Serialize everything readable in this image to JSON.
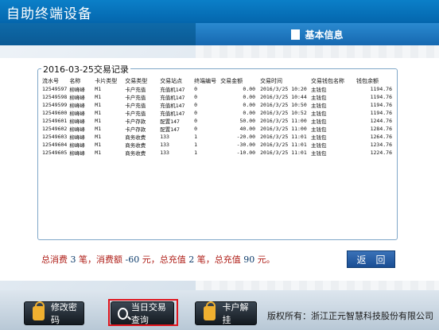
{
  "app_title": "自助终端设备",
  "info_panel": {
    "title": "基本信息"
  },
  "dialog": {
    "title": "2016-03-25交易记录",
    "columns": [
      "流水号",
      "名称",
      "卡片类型",
      "交易类型",
      "交易站点",
      "终端编号",
      "交易金额",
      "交易时间",
      "交易钱包名称",
      "钱包余额"
    ],
    "rows": [
      [
        "12549597",
        "柳峰峰",
        "M1",
        "卡户充值",
        "充值机147",
        "0",
        "0.00",
        "2016/3/25 10:20",
        "主钱包",
        "1194.76"
      ],
      [
        "12549598",
        "柳峰峰",
        "M1",
        "卡户充值",
        "充值机147",
        "0",
        "0.00",
        "2016/3/25 10:44",
        "主钱包",
        "1194.76"
      ],
      [
        "12549599",
        "柳峰峰",
        "M1",
        "卡户充值",
        "充值机147",
        "0",
        "0.00",
        "2016/3/25 10:50",
        "主钱包",
        "1194.76"
      ],
      [
        "12549600",
        "柳峰峰",
        "M1",
        "卡户充值",
        "充值机147",
        "0",
        "0.00",
        "2016/3/25 10:52",
        "主钱包",
        "1194.76"
      ],
      [
        "12549601",
        "柳峰峰",
        "M1",
        "卡户存款",
        "配置147",
        "0",
        "50.00",
        "2016/3/25 11:00",
        "主钱包",
        "1244.76"
      ],
      [
        "12549602",
        "柳峰峰",
        "M1",
        "卡户存款",
        "配置147",
        "0",
        "40.00",
        "2016/3/25 11:00",
        "主钱包",
        "1284.76"
      ],
      [
        "12549603",
        "柳峰峰",
        "M1",
        "商务收费",
        "133",
        "1",
        "-20.00",
        "2016/3/25 11:01",
        "主钱包",
        "1264.76"
      ],
      [
        "12549604",
        "柳峰峰",
        "M1",
        "商务收费",
        "133",
        "1",
        "-30.00",
        "2016/3/25 11:01",
        "主钱包",
        "1234.76"
      ],
      [
        "12549605",
        "柳峰峰",
        "M1",
        "商务收费",
        "133",
        "1",
        "-10.00",
        "2016/3/25 11:01",
        "主钱包",
        "1224.76"
      ]
    ],
    "summary": {
      "t1": "总消费",
      "consume_count": "3",
      "t2": "笔，消费额",
      "consume_amount": "-60",
      "t3": "元，总充值",
      "recharge_count": "2",
      "t4": "笔，总充值",
      "recharge_amount": "90",
      "t5": "元。"
    },
    "return_label": "返　回"
  },
  "bottom": {
    "change_password": "修改密码",
    "today_query": "当日交易查询",
    "unlock_card": "卡户解挂",
    "copyright": "版权所有：浙江正元智慧科技股份有限公司"
  },
  "colors": {
    "title_bar": "#0b7fc8",
    "summary_text": "#b0201a",
    "highlight_frame": "#e0141c"
  }
}
